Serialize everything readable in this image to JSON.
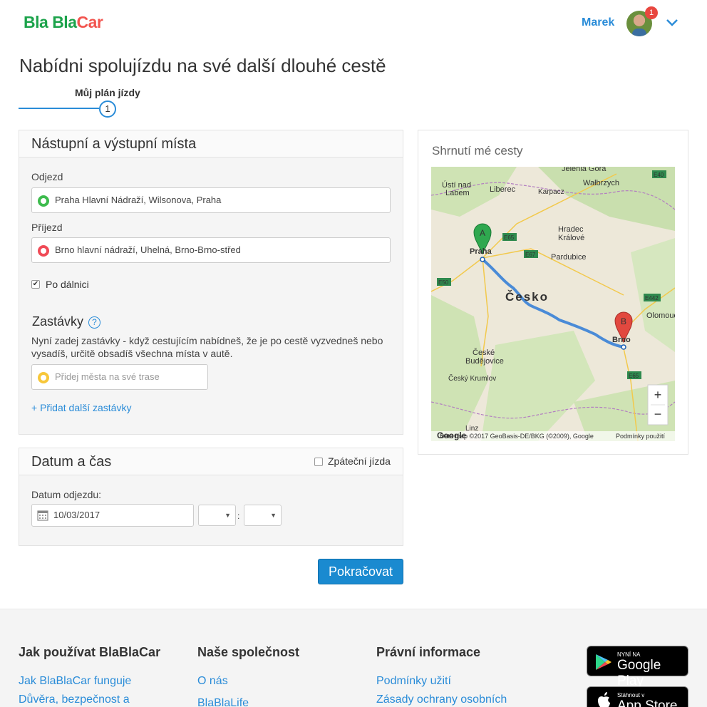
{
  "header": {
    "logo_bla1": "Bla",
    "logo_bla2": "Bla",
    "logo_car": "Car",
    "user_name": "Marek",
    "notification_count": "1"
  },
  "page": {
    "title": "Nabídni spolujízdu na své další dlouhé cestě",
    "step_label": "Můj plán jízdy",
    "step_number": "1"
  },
  "places": {
    "title": "Nástupní a výstupní místa",
    "departure_label": "Odjezd",
    "departure_value": "Praha Hlavní Nádraží, Wilsonova, Praha",
    "arrival_label": "Příjezd",
    "arrival_value": "Brno hlavní nádraží, Uhelná, Brno-Brno-střed",
    "highway_label": "Po dálnici",
    "highway_checked": true
  },
  "stops": {
    "title": "Zastávky",
    "help": "?",
    "description": "Nyní zadej zastávky - když cestujícím nabídneš, že je po cestě vyzvedneš nebo vysadíš, určitě obsadíš všechna místa v autě.",
    "placeholder": "Přidej města na své trase",
    "add_link": "+ Přidat další zastávky"
  },
  "datetime": {
    "title": "Datum a čas",
    "return_label": "Zpáteční jízda",
    "date_label": "Datum odjezdu:",
    "date_value": "10/03/2017",
    "time_separator": ":"
  },
  "continue_button": "Pokračovat",
  "summary": {
    "title": "Shrnutí mé cesty",
    "map": {
      "marker_a": "A",
      "marker_b": "B",
      "zoom_in": "+",
      "zoom_out": "−",
      "attribution": "Data map ©2017 GeoBasis-DE/BKG (©2009), Google",
      "terms": "Podmínky použití",
      "labels": [
        "Jelenia Góra",
        "Wałbrzych",
        "Ústí nad Labem",
        "Liberec",
        "Karpacz",
        "Hradec Králové",
        "Pardubice",
        "Praha",
        "Česko",
        "Olomouc",
        "Brno",
        "České Budějovice",
        "Český Krumlov",
        "Linz"
      ],
      "road_labels": [
        "E40",
        "E65",
        "E67",
        "E50",
        "E442",
        "E65"
      ]
    }
  },
  "footer": {
    "col1_title": "Jak používat BlaBlaCar",
    "col1_links": [
      "Jak BlaBlaCar funguje",
      "Důvěra, bezpečnost a"
    ],
    "col2_title": "Naše společnost",
    "col2_links": [
      "O nás",
      "BlaBlaLife"
    ],
    "col3_title": "Právní informace",
    "col3_links": [
      "Podmínky užití",
      "Zásady ochrany osobních"
    ],
    "google_play_small": "NYNÍ NA",
    "google_play_big": "Google Play",
    "app_store_small": "Stáhnout v",
    "app_store_big": "App Store"
  }
}
